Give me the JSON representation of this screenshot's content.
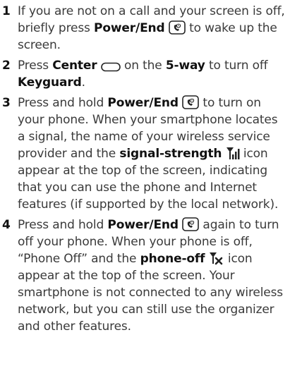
{
  "steps": [
    {
      "number": "1",
      "parts": [
        {
          "t": "If you are not on a call and your screen is off, briefly press "
        },
        {
          "b": "Power/End"
        },
        {
          "icon": "power-end-key-icon"
        },
        {
          "t": " to wake up the screen."
        }
      ]
    },
    {
      "number": "2",
      "parts": [
        {
          "t": "Press "
        },
        {
          "b": "Center"
        },
        {
          "icon": "center-button-icon"
        },
        {
          "t": " on the "
        },
        {
          "b": "5-way"
        },
        {
          "t": " to turn off "
        },
        {
          "b": "Keyguard"
        },
        {
          "t": "."
        }
      ]
    },
    {
      "number": "3",
      "parts": [
        {
          "t": "Press and hold "
        },
        {
          "b": "Power/End"
        },
        {
          "icon": "power-end-key-icon"
        },
        {
          "t": " to turn on your phone. When your smartphone locates a signal, the name of your wireless service provider and the "
        },
        {
          "b": "signal-strength"
        },
        {
          "icon": "signal-strength-icon"
        },
        {
          "t": " icon appear at the top of the screen, indicating that you can use the phone and Internet features (if supported by the local network)."
        }
      ]
    },
    {
      "number": "4",
      "parts": [
        {
          "t": "Press and hold "
        },
        {
          "b": "Power/End"
        },
        {
          "icon": "power-end-key-icon"
        },
        {
          "t": " again to turn off your phone. When your phone is off, “Phone Off” and the "
        },
        {
          "b": "phone-off"
        },
        {
          "icon": "phone-off-icon"
        },
        {
          "t": " icon appear at the top of the screen. Your smartphone is not connected to any wireless network, but you can still use the organizer and other features."
        }
      ]
    }
  ]
}
